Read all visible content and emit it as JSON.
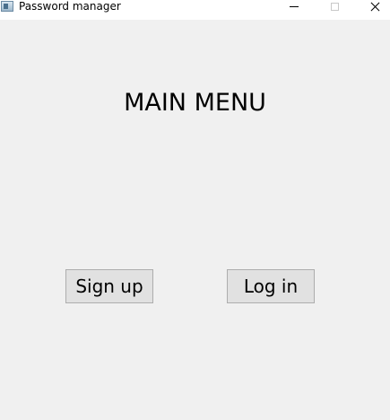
{
  "window": {
    "title": "Password manager",
    "controls": {
      "minimize": "minimize-icon",
      "maximize": "maximize-icon",
      "close": "close-icon"
    }
  },
  "main": {
    "heading": "MAIN MENU",
    "buttons": {
      "signup_label": "Sign up",
      "login_label": "Log in"
    }
  },
  "colors": {
    "background": "#f0f0f0",
    "titlebar": "#ffffff",
    "button_face": "#e1e1e1",
    "button_border": "#adadad"
  }
}
